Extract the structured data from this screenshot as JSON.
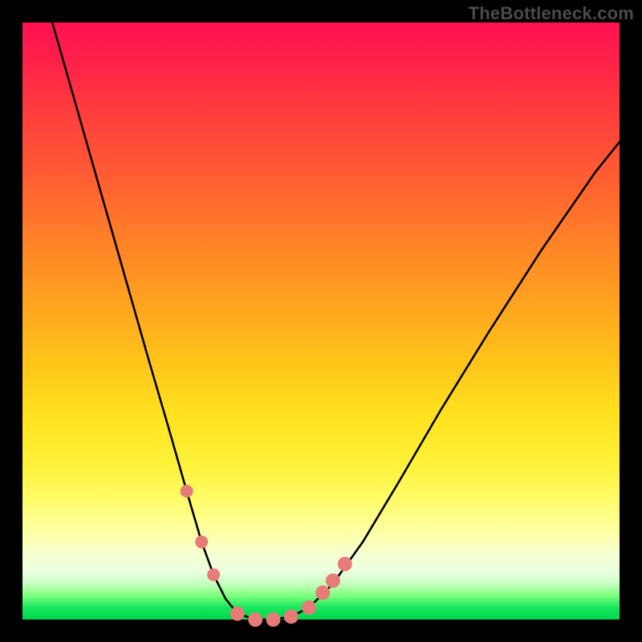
{
  "watermark": "TheBottleneck.com",
  "chart_data": {
    "type": "line",
    "title": "",
    "xlabel": "",
    "ylabel": "",
    "xlim": [
      0,
      1
    ],
    "ylim": [
      0,
      1
    ],
    "series": [
      {
        "name": "curve",
        "x": [
          0.05,
          0.09,
          0.13,
          0.17,
          0.21,
          0.245,
          0.275,
          0.3,
          0.32,
          0.34,
          0.36,
          0.39,
          0.42,
          0.45,
          0.48,
          0.52,
          0.57,
          0.63,
          0.7,
          0.78,
          0.87,
          0.96,
          1.0
        ],
        "y": [
          1.0,
          0.86,
          0.72,
          0.58,
          0.44,
          0.32,
          0.215,
          0.13,
          0.075,
          0.035,
          0.01,
          0.0,
          0.0,
          0.005,
          0.02,
          0.06,
          0.13,
          0.23,
          0.35,
          0.48,
          0.62,
          0.75,
          0.8
        ]
      }
    ],
    "markers": [
      {
        "name": "left-dot-1",
        "x": 0.275,
        "y": 0.215,
        "r": 8
      },
      {
        "name": "left-dot-2",
        "x": 0.3,
        "y": 0.13,
        "r": 8
      },
      {
        "name": "left-dot-3",
        "x": 0.32,
        "y": 0.075,
        "r": 8
      },
      {
        "name": "trough-1",
        "x": 0.36,
        "y": 0.01,
        "r": 9
      },
      {
        "name": "trough-2",
        "x": 0.39,
        "y": 0.0,
        "r": 9
      },
      {
        "name": "trough-3",
        "x": 0.42,
        "y": 0.0,
        "r": 9
      },
      {
        "name": "trough-4",
        "x": 0.45,
        "y": 0.005,
        "r": 9
      },
      {
        "name": "right-dot-1",
        "x": 0.48,
        "y": 0.02,
        "r": 9
      },
      {
        "name": "right-dot-2",
        "x": 0.503,
        "y": 0.045,
        "r": 9
      },
      {
        "name": "right-dot-3",
        "x": 0.52,
        "y": 0.065,
        "r": 9
      },
      {
        "name": "right-dot-4",
        "x": 0.54,
        "y": 0.093,
        "r": 9
      }
    ],
    "marker_color": "#e77b78",
    "curve_color": "#000000",
    "curve_width": 2.6
  }
}
